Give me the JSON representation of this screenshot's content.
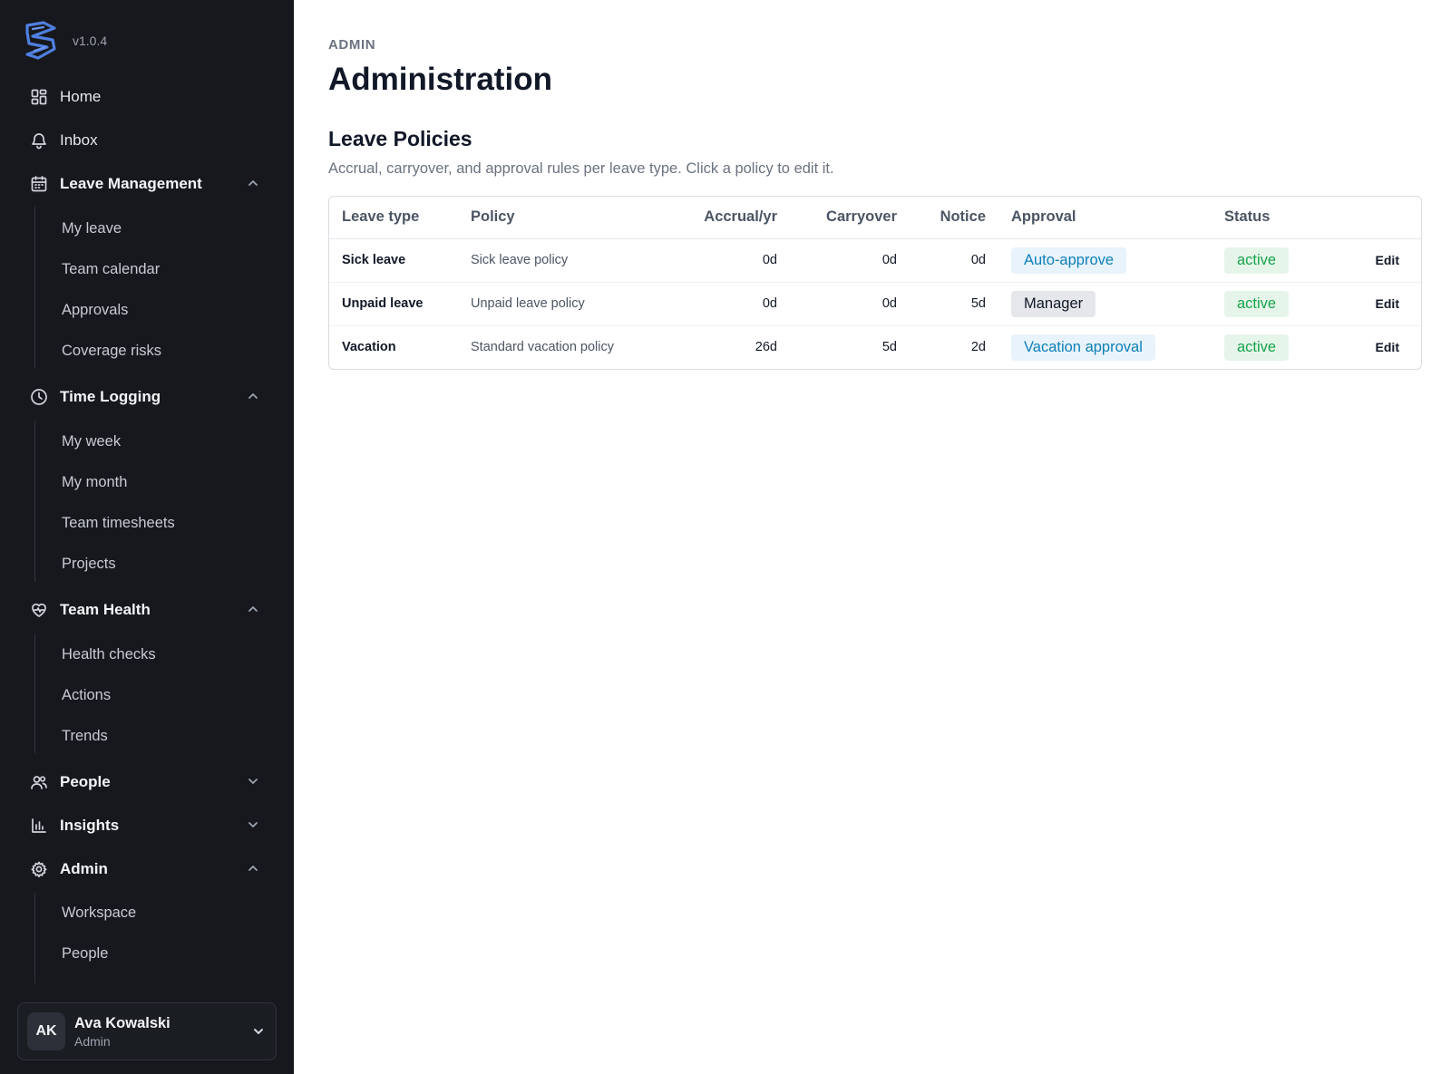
{
  "app": {
    "version": "v1.0.4"
  },
  "sidebar": {
    "home": "Home",
    "inbox": "Inbox",
    "leave_management": {
      "label": "Leave Management",
      "items": [
        "My leave",
        "Team calendar",
        "Approvals",
        "Coverage risks"
      ]
    },
    "time_logging": {
      "label": "Time Logging",
      "items": [
        "My week",
        "My month",
        "Team timesheets",
        "Projects"
      ]
    },
    "team_health": {
      "label": "Team Health",
      "items": [
        "Health checks",
        "Actions",
        "Trends"
      ]
    },
    "people": {
      "label": "People"
    },
    "insights": {
      "label": "Insights"
    },
    "admin": {
      "label": "Admin",
      "items": [
        "Workspace",
        "People"
      ]
    },
    "user": {
      "initials": "AK",
      "name": "Ava Kowalski",
      "role": "Admin"
    }
  },
  "main": {
    "eyebrow": "ADMIN",
    "title": "Administration",
    "section_title": "Leave Policies",
    "section_desc": "Accrual, carryover, and approval rules per leave type. Click a policy to edit it.",
    "table": {
      "headers": [
        "Leave type",
        "Policy",
        "Accrual/yr",
        "Carryover",
        "Notice",
        "Approval",
        "Status"
      ],
      "rows": [
        {
          "type": "Sick leave",
          "policy": "Sick leave policy",
          "accrual": "0d",
          "carryover": "0d",
          "notice": "0d",
          "approval": "Auto-approve",
          "status": "active",
          "action": "Edit"
        },
        {
          "type": "Unpaid leave",
          "policy": "Unpaid leave policy",
          "accrual": "0d",
          "carryover": "0d",
          "notice": "5d",
          "approval": "Manager",
          "status": "active",
          "action": "Edit"
        },
        {
          "type": "Vacation",
          "policy": "Standard vacation policy",
          "accrual": "26d",
          "carryover": "5d",
          "notice": "2d",
          "approval": "Vacation approval",
          "status": "active",
          "action": "Edit"
        }
      ]
    }
  },
  "colors": {
    "sidebar_bg": "#16181d",
    "badge_blue_text": "#0e7fb8",
    "badge_green_text": "#16a34a",
    "brand_blue": "#4f7fe0"
  }
}
